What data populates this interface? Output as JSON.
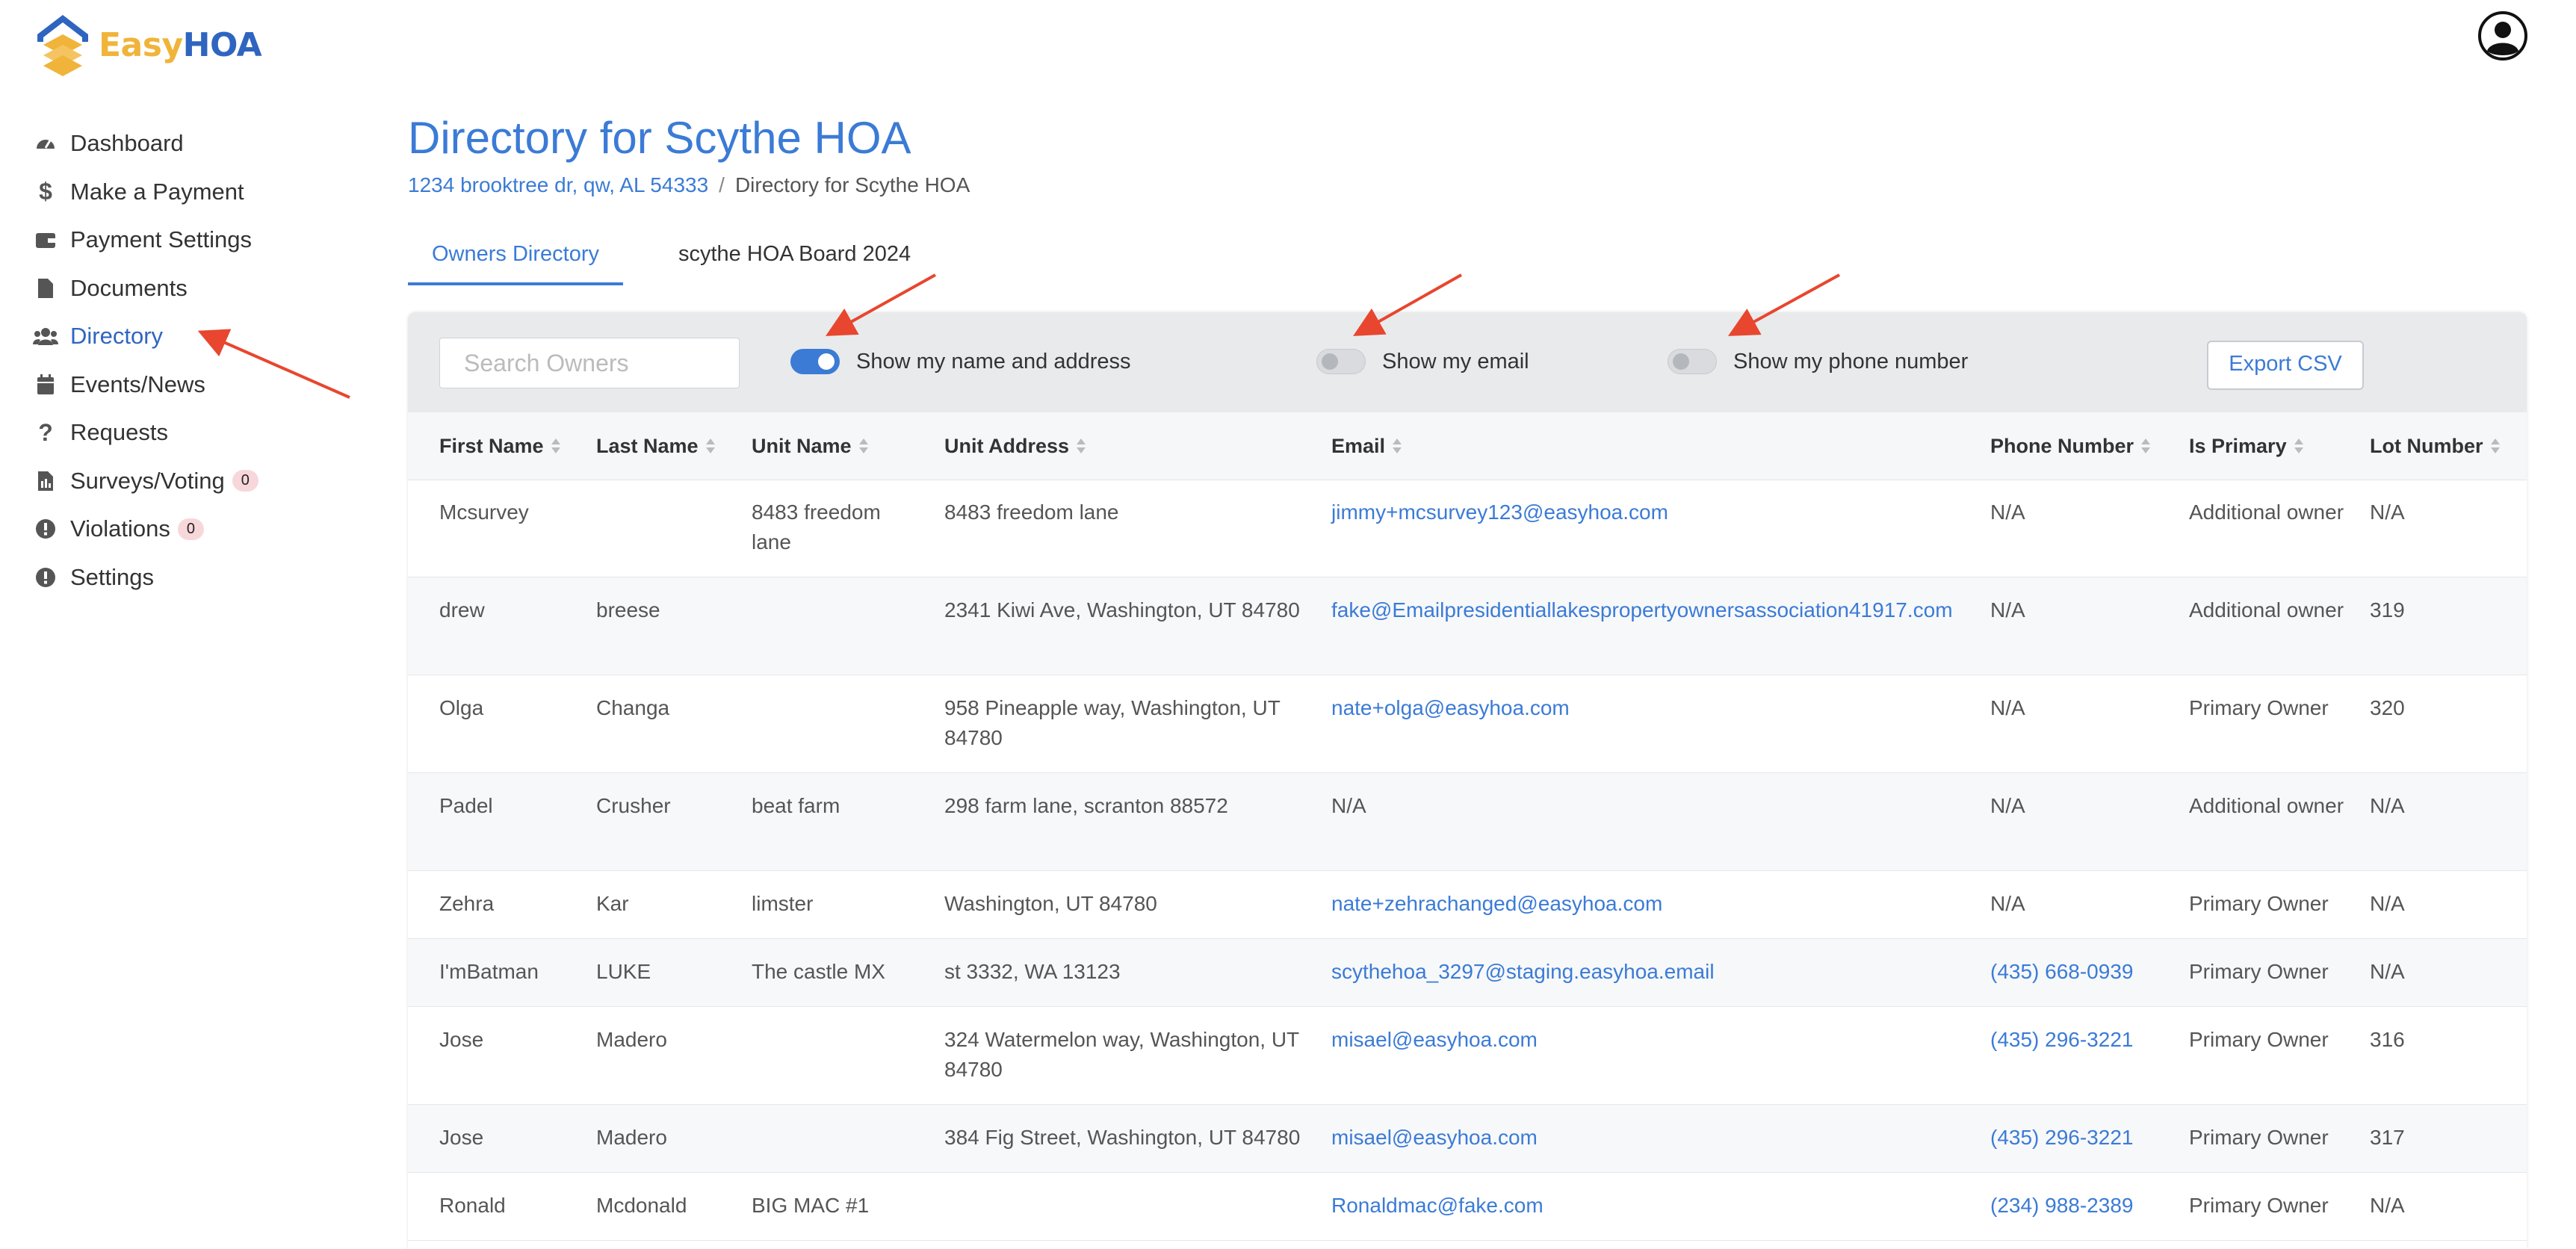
{
  "brand": {
    "easy": "Easy",
    "hoa": "HOA"
  },
  "sidebar": {
    "items": [
      {
        "label": "Dashboard",
        "icon": "dashboard-icon"
      },
      {
        "label": "Make a Payment",
        "icon": "dollar-icon"
      },
      {
        "label": "Payment Settings",
        "icon": "wallet-icon"
      },
      {
        "label": "Documents",
        "icon": "document-icon"
      },
      {
        "label": "Directory",
        "icon": "users-icon"
      },
      {
        "label": "Events/News",
        "icon": "calendar-icon"
      },
      {
        "label": "Requests",
        "icon": "question-icon"
      },
      {
        "label": "Surveys/Voting",
        "icon": "survey-icon",
        "badge": "0"
      },
      {
        "label": "Violations",
        "icon": "alert-icon",
        "badge": "0"
      },
      {
        "label": "Settings",
        "icon": "info-icon"
      }
    ]
  },
  "page": {
    "title": "Directory for Scythe HOA",
    "breadcrumb": {
      "link": "1234 brooktree dr, qw, AL 54333",
      "separator": "/",
      "current": "Directory for Scythe HOA"
    }
  },
  "tabs": [
    {
      "label": "Owners Directory",
      "active": true
    },
    {
      "label": "scythe HOA Board 2024",
      "active": false
    }
  ],
  "toolbar": {
    "search_placeholder": "Search Owners",
    "toggles": [
      {
        "label": "Show my name and address",
        "on": true
      },
      {
        "label": "Show my email",
        "on": false
      },
      {
        "label": "Show my phone number",
        "on": false
      }
    ],
    "export_label": "Export CSV"
  },
  "table": {
    "columns": [
      "First Name",
      "Last Name",
      "Unit Name",
      "Unit Address",
      "Email",
      "Phone Number",
      "Is Primary",
      "Lot Number"
    ],
    "rows": [
      {
        "first": "Mcsurvey",
        "last": "",
        "unit_name": "8483 freedom lane",
        "address": "8483 freedom lane",
        "email": "jimmy+mcsurvey123@easyhoa.com",
        "phone": "N/A",
        "primary": "Additional owner",
        "lot": "N/A"
      },
      {
        "first": "drew",
        "last": "breese",
        "unit_name": "",
        "address": "2341 Kiwi Ave, Washington, UT 84780",
        "email": "fake@Emailpresidentiallakespropertyownersassociation41917.com",
        "phone": "N/A",
        "primary": "Additional owner",
        "lot": "319"
      },
      {
        "first": "Olga",
        "last": "Changa",
        "unit_name": "",
        "address": "958 Pineapple way, Washington, UT 84780",
        "email": "nate+olga@easyhoa.com",
        "phone": "N/A",
        "primary": "Primary Owner",
        "lot": "320"
      },
      {
        "first": "Padel",
        "last": "Crusher",
        "unit_name": "beat farm",
        "address": "298 farm lane, scranton 88572",
        "email": "N/A",
        "phone": "N/A",
        "primary": "Additional owner",
        "lot": "N/A"
      },
      {
        "first": "Zehra",
        "last": "Kar",
        "unit_name": "limster",
        "address": "Washington, UT 84780",
        "email": "nate+zehrachanged@easyhoa.com",
        "phone": "N/A",
        "primary": "Primary Owner",
        "lot": "N/A"
      },
      {
        "first": "I'mBatman",
        "last": "LUKE",
        "unit_name": "The castle MX",
        "address": "st 3332, WA 13123",
        "email": "scythehoa_3297@staging.easyhoa.email",
        "phone": "(435) 668-0939",
        "primary": "Primary Owner",
        "lot": "N/A"
      },
      {
        "first": "Jose",
        "last": "Madero",
        "unit_name": "",
        "address": "324 Watermelon way, Washington, UT 84780",
        "email": "misael@easyhoa.com",
        "phone": "(435) 296-3221",
        "primary": "Primary Owner",
        "lot": "316"
      },
      {
        "first": "Jose",
        "last": "Madero",
        "unit_name": "",
        "address": "384 Fig Street, Washington, UT 84780",
        "email": "misael@easyhoa.com",
        "phone": "(435) 296-3221",
        "primary": "Primary Owner",
        "lot": "317"
      },
      {
        "first": "Ronald",
        "last": "Mcdonald",
        "unit_name": "BIG MAC #1",
        "address": "",
        "email": "Ronaldmac@fake.com",
        "phone": "(234) 988-2389",
        "primary": "Primary Owner",
        "lot": "N/A"
      }
    ]
  },
  "colors": {
    "accent": "#3b7bd6",
    "annotation_arrow": "#e8462e",
    "badge_bg": "#f8d7da"
  }
}
